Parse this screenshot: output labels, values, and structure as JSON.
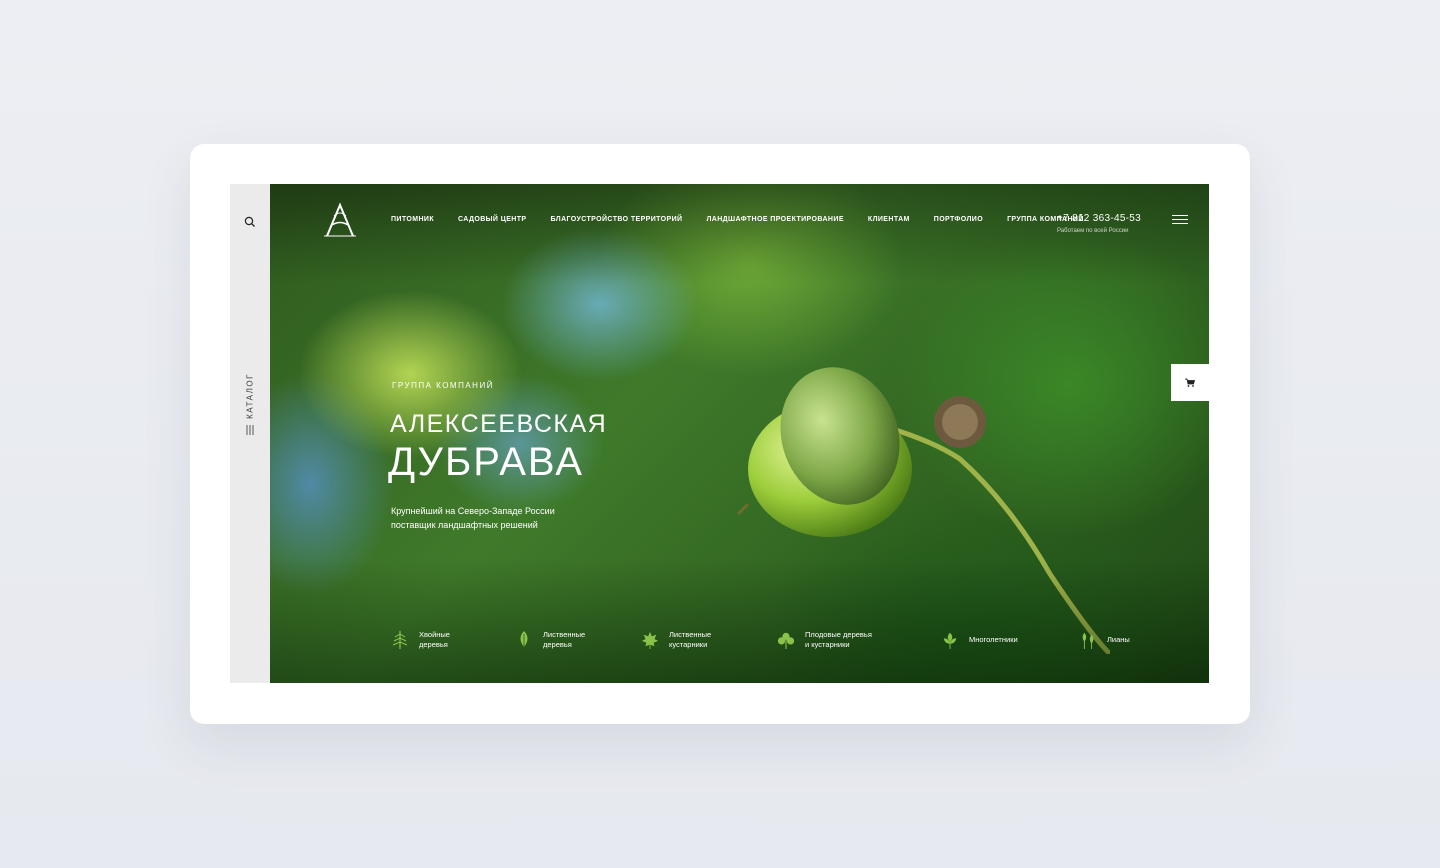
{
  "sidebar": {
    "catalog_label": "КАТАЛОГ"
  },
  "nav": {
    "items": [
      "ПИТОМНИК",
      "САДОВЫЙ ЦЕНТР",
      "БЛАГОУСТРОЙСТВО ТЕРРИТОРИЙ",
      "ЛАНДШАФТНОЕ ПРОЕКТИРОВАНИЕ",
      "КЛИЕНТАМ",
      "ПОРТФОЛИО",
      "ГРУППА КОМПАНИЙ"
    ]
  },
  "contact": {
    "phone": "+7 812 363-45-53",
    "note": "Работаем по всей России"
  },
  "hero": {
    "eyebrow": "ГРУППА КОМПАНИЙ",
    "title_line1": "АЛЕКСЕЕВСКАЯ",
    "title_line2": "ДУБРАВА",
    "lead": "Крупнейший на Северо-Западе России поставщик ландшафтных решений"
  },
  "categories": [
    {
      "line1": "Хвойные",
      "line2": "деревья",
      "icon": "conifer-icon"
    },
    {
      "line1": "Лиственные",
      "line2": "деревья",
      "icon": "leaf-icon"
    },
    {
      "line1": "Лиственные",
      "line2": "кустарники",
      "icon": "maple-leaf-icon"
    },
    {
      "line1": "Плодовые деревья",
      "line2": "и кустарники",
      "icon": "fruit-tree-icon"
    },
    {
      "line1": "Многолетники",
      "line2": "",
      "icon": "perennial-icon"
    },
    {
      "line1": "Лианы",
      "line2": "",
      "icon": "vine-icon"
    }
  ],
  "colors": {
    "accent_green": "#8bc34a",
    "sidebar_bg": "#ebebeb"
  }
}
